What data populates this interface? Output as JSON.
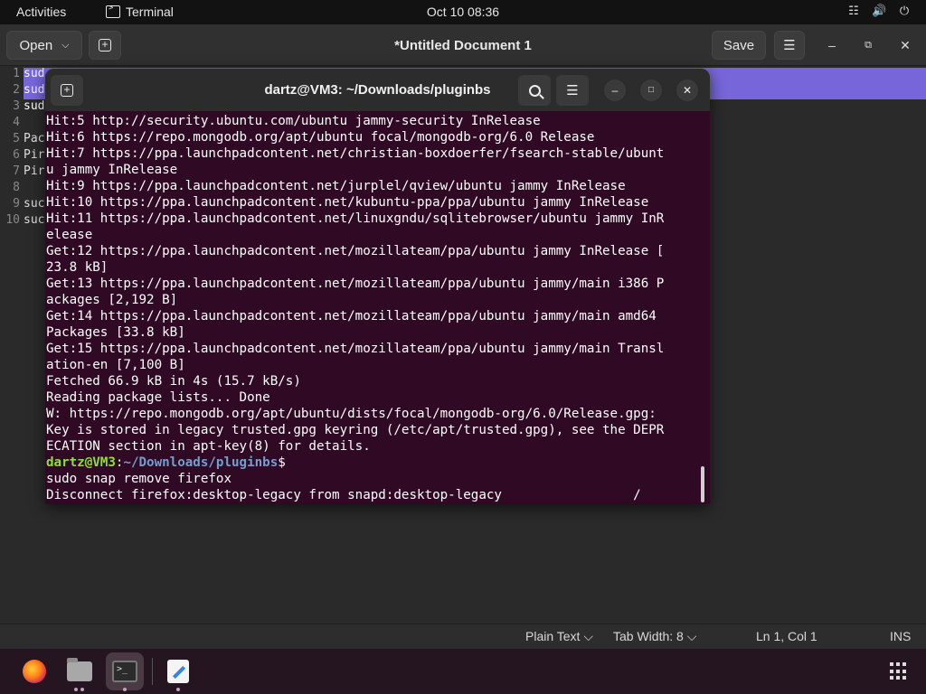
{
  "topbar": {
    "activities": "Activities",
    "app_name": "Terminal",
    "clock": "Oct 10  08:36",
    "tray": [
      "network-icon",
      "volume-icon",
      "power-icon"
    ]
  },
  "editor": {
    "open_label": "Open",
    "title": "*Untitled Document 1",
    "save_label": "Save",
    "line_numbers": [
      "1",
      "2",
      "3",
      "4",
      "5",
      "6",
      "7",
      "8",
      "9",
      "10"
    ],
    "visible_lines": [
      "sud",
      "sud",
      "sud",
      "",
      "Pac",
      "Pir",
      "Pir",
      "",
      "suc",
      "suc"
    ],
    "status": {
      "language": "Plain Text",
      "tab_width": "Tab Width: 8",
      "position": "Ln 1, Col 1",
      "mode": "INS"
    }
  },
  "terminal": {
    "title": "dartz@VM3: ~/Downloads/pluginbs",
    "lines_before": [
      "Hit:5 http://security.ubuntu.com/ubuntu jammy-security InRelease",
      "Hit:6 https://repo.mongodb.org/apt/ubuntu focal/mongodb-org/6.0 Release",
      "Hit:7 https://ppa.launchpadcontent.net/christian-boxdoerfer/fsearch-stable/ubunt",
      "u jammy InRelease",
      "Hit:9 https://ppa.launchpadcontent.net/jurplel/qview/ubuntu jammy InRelease",
      "Hit:10 https://ppa.launchpadcontent.net/kubuntu-ppa/ppa/ubuntu jammy InRelease",
      "Hit:11 https://ppa.launchpadcontent.net/linuxgndu/sqlitebrowser/ubuntu jammy InR",
      "elease",
      "Get:12 https://ppa.launchpadcontent.net/mozillateam/ppa/ubuntu jammy InRelease [",
      "23.8 kB]",
      "Get:13 https://ppa.launchpadcontent.net/mozillateam/ppa/ubuntu jammy/main i386 P",
      "ackages [2,192 B]",
      "Get:14 https://ppa.launchpadcontent.net/mozillateam/ppa/ubuntu jammy/main amd64",
      "Packages [33.8 kB]",
      "Get:15 https://ppa.launchpadcontent.net/mozillateam/ppa/ubuntu jammy/main Transl",
      "ation-en [7,100 B]",
      "Fetched 66.9 kB in 4s (15.7 kB/s)",
      "Reading package lists... Done",
      "W: https://repo.mongodb.org/apt/ubuntu/dists/focal/mongodb-org/6.0/Release.gpg:",
      "Key is stored in legacy trusted.gpg keyring (/etc/apt/trusted.gpg), see the DEPR",
      "ECATION section in apt-key(8) for details."
    ],
    "prompt_user": "dartz@VM3",
    "prompt_sep": ":",
    "prompt_path": "~/Downloads/pluginbs",
    "prompt_end": "$",
    "command": "sudo snap remove firefox",
    "progress_line": "Disconnect firefox:desktop-legacy from snapd:desktop-legacy                 /"
  },
  "dock": {
    "items": [
      "firefox-icon",
      "files-icon",
      "terminal-icon",
      "text-editor-icon"
    ],
    "show_apps": "show-applications-icon"
  }
}
